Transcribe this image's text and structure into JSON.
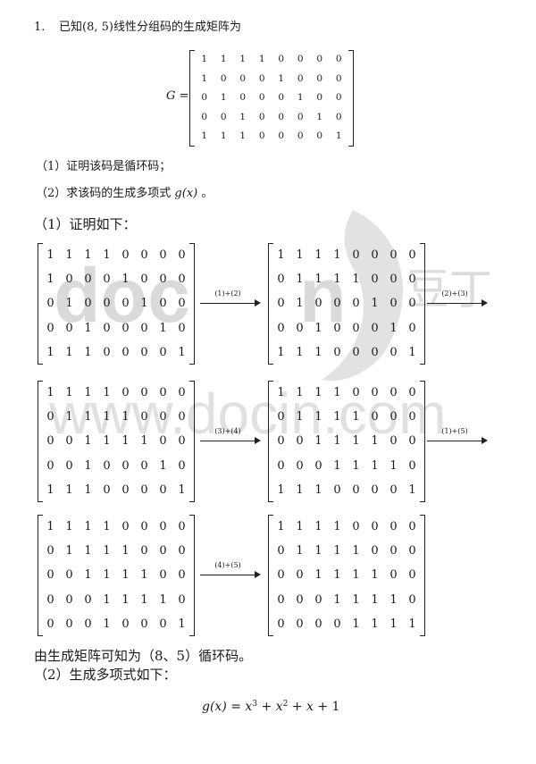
{
  "problem": {
    "number": "1.",
    "statement": "已知(8, 5)线性分组码的生成矩阵为",
    "matrix_label": "G =",
    "G": [
      [
        "1",
        "1",
        "1",
        "1",
        "0",
        "0",
        "0",
        "0"
      ],
      [
        "1",
        "0",
        "0",
        "0",
        "1",
        "0",
        "0",
        "0"
      ],
      [
        "0",
        "1",
        "0",
        "0",
        "0",
        "1",
        "0",
        "0"
      ],
      [
        "0",
        "0",
        "1",
        "0",
        "0",
        "0",
        "1",
        "0"
      ],
      [
        "1",
        "1",
        "1",
        "0",
        "0",
        "0",
        "0",
        "1"
      ]
    ],
    "q1": "（1）证明该码是循环码；",
    "q2_text": "（2）求该码的生成多项式",
    "q2_math": "g(x)",
    "q2_end": "。"
  },
  "solution": {
    "part1_heading": "（1）证明如下：",
    "steps": [
      {
        "matrix": [
          [
            "1",
            "1",
            "1",
            "1",
            "0",
            "0",
            "0",
            "0"
          ],
          [
            "1",
            "0",
            "0",
            "0",
            "1",
            "0",
            "0",
            "0"
          ],
          [
            "0",
            "1",
            "0",
            "0",
            "0",
            "1",
            "0",
            "0"
          ],
          [
            "0",
            "0",
            "1",
            "0",
            "0",
            "0",
            "1",
            "0"
          ],
          [
            "1",
            "1",
            "1",
            "0",
            "0",
            "0",
            "0",
            "1"
          ]
        ],
        "op": "(1)+(2)"
      },
      {
        "matrix": [
          [
            "1",
            "1",
            "1",
            "1",
            "0",
            "0",
            "0",
            "0"
          ],
          [
            "0",
            "1",
            "1",
            "1",
            "1",
            "0",
            "0",
            "0"
          ],
          [
            "0",
            "1",
            "0",
            "0",
            "0",
            "1",
            "0",
            "0"
          ],
          [
            "0",
            "0",
            "1",
            "0",
            "0",
            "0",
            "1",
            "0"
          ],
          [
            "1",
            "1",
            "1",
            "0",
            "0",
            "0",
            "0",
            "1"
          ]
        ],
        "op": "(2)+(3)"
      },
      {
        "matrix": [
          [
            "1",
            "1",
            "1",
            "1",
            "0",
            "0",
            "0",
            "0"
          ],
          [
            "0",
            "1",
            "1",
            "1",
            "1",
            "0",
            "0",
            "0"
          ],
          [
            "0",
            "0",
            "1",
            "1",
            "1",
            "1",
            "0",
            "0"
          ],
          [
            "0",
            "0",
            "1",
            "0",
            "0",
            "0",
            "1",
            "0"
          ],
          [
            "1",
            "1",
            "1",
            "0",
            "0",
            "0",
            "0",
            "1"
          ]
        ],
        "op": "(3)+(4)"
      },
      {
        "matrix": [
          [
            "1",
            "1",
            "1",
            "1",
            "0",
            "0",
            "0",
            "0"
          ],
          [
            "0",
            "1",
            "1",
            "1",
            "1",
            "0",
            "0",
            "0"
          ],
          [
            "0",
            "0",
            "1",
            "1",
            "1",
            "1",
            "0",
            "0"
          ],
          [
            "0",
            "0",
            "0",
            "1",
            "1",
            "1",
            "1",
            "0"
          ],
          [
            "1",
            "1",
            "1",
            "0",
            "0",
            "0",
            "0",
            "1"
          ]
        ],
        "op": "(1)+(5)"
      },
      {
        "matrix": [
          [
            "1",
            "1",
            "1",
            "1",
            "0",
            "0",
            "0",
            "0"
          ],
          [
            "0",
            "1",
            "1",
            "1",
            "1",
            "0",
            "0",
            "0"
          ],
          [
            "0",
            "0",
            "1",
            "1",
            "1",
            "1",
            "0",
            "0"
          ],
          [
            "0",
            "0",
            "0",
            "1",
            "1",
            "1",
            "1",
            "0"
          ],
          [
            "0",
            "0",
            "0",
            "1",
            "0",
            "0",
            "0",
            "1"
          ]
        ],
        "op": "(4)+(5)"
      },
      {
        "matrix": [
          [
            "1",
            "1",
            "1",
            "1",
            "0",
            "0",
            "0",
            "0"
          ],
          [
            "0",
            "1",
            "1",
            "1",
            "1",
            "0",
            "0",
            "0"
          ],
          [
            "0",
            "0",
            "1",
            "1",
            "1",
            "1",
            "0",
            "0"
          ],
          [
            "0",
            "0",
            "0",
            "1",
            "1",
            "1",
            "1",
            "0"
          ],
          [
            "0",
            "0",
            "0",
            "0",
            "1",
            "1",
            "1",
            "1"
          ]
        ],
        "op": ""
      }
    ],
    "conclusion": "由生成矩阵可知为（8、5）循环码。",
    "part2_heading": "（2）生成多项式如下：",
    "poly": {
      "lhs": "g(x)",
      "eq": "=",
      "t1": "x",
      "e1": "3",
      "plus1": "+",
      "t2": "x",
      "e2": "2",
      "plus2": "+",
      "t3": "x",
      "plus3": "+",
      "t4": "1"
    }
  },
  "watermark": {
    "text_large": "doc",
    "text_large_end": "n",
    "text_url": "www.docin.com",
    "brand_cn": "豆丁",
    "color": "#d9d9d9"
  }
}
